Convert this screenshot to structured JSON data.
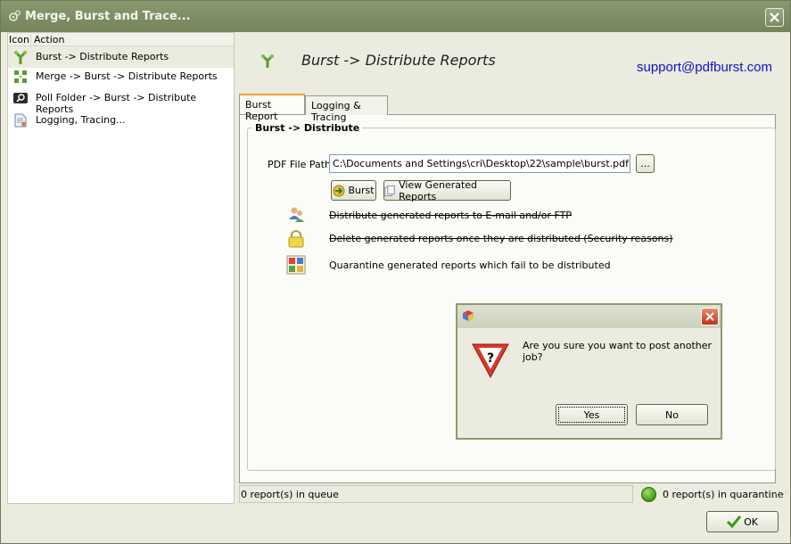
{
  "window": {
    "title": "Merge, Burst and Trace..."
  },
  "left_panel": {
    "columns": [
      "Icon",
      "Action"
    ],
    "items": [
      {
        "label": "Burst -> Distribute Reports",
        "icon": "burst-icon"
      },
      {
        "label": "Merge -> Burst -> Distribute Reports",
        "icon": "merge-icon"
      },
      {
        "label": "Poll Folder -> Burst -> Distribute Reports",
        "icon": "poll-folder-icon"
      },
      {
        "label": "Logging, Tracing...",
        "icon": "logging-icon"
      }
    ]
  },
  "header": {
    "title": "Burst -> Distribute Reports",
    "support_email": "support@pdfburst.com"
  },
  "tabs": [
    {
      "label": "Burst Report"
    },
    {
      "label": "Logging & Tracing"
    }
  ],
  "burst_group": {
    "title": "Burst -> Distribute",
    "pdf_path_label": "PDF File Path",
    "pdf_path_value": "C:\\Documents and Settings\\cri\\Desktop\\22\\sample\\burst.pdf",
    "browse_label": "...",
    "burst_button": "Burst",
    "view_button": "View Generated Reports",
    "options": [
      {
        "label": "Distribute generated reports to E-mail and/or FTP",
        "icon": "users-icon",
        "enabled": false
      },
      {
        "label": "Delete generated reports once they are distributed (Security reasons)",
        "icon": "lock-icon",
        "enabled": false
      },
      {
        "label": "Quarantine generated reports which fail to be distributed",
        "icon": "quarantine-icon",
        "enabled": true
      }
    ]
  },
  "status": {
    "queue_text": "0 report(s) in queue",
    "quarantine_text": "0 report(s) in quarantine",
    "led_color": "#3c9a16"
  },
  "ok_button": "OK",
  "dialog": {
    "message": "Are you sure you want to post another job?",
    "yes": "Yes",
    "no": "No"
  },
  "colors": {
    "titlebar": "#7c8b62",
    "support_link": "#1010c8",
    "tab_accent": "#e8a52c"
  }
}
